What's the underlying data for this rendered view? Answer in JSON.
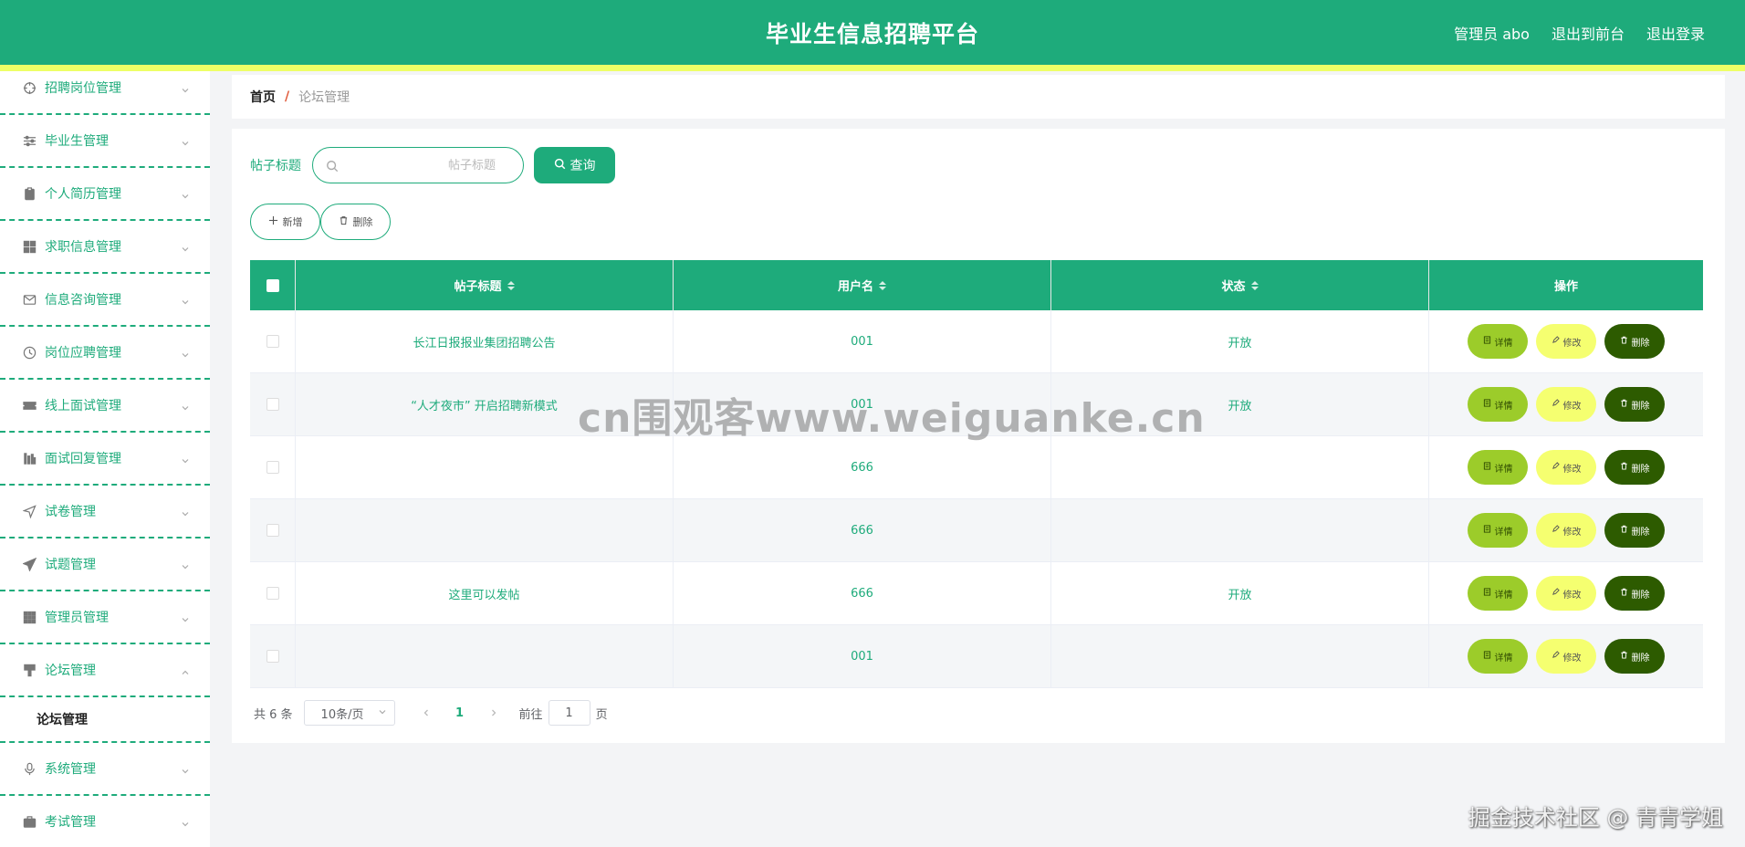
{
  "header": {
    "title": "毕业生信息招聘平台",
    "admin_label": "管理员 abo",
    "goto_front": "退出到前台",
    "logout": "退出登录"
  },
  "sidebar": {
    "items": [
      {
        "label": "招聘岗位管理",
        "icon": "crosshair-icon"
      },
      {
        "label": "毕业生管理",
        "icon": "sliders-icon"
      },
      {
        "label": "个人简历管理",
        "icon": "clipboard-icon"
      },
      {
        "label": "求职信息管理",
        "icon": "grid-icon"
      },
      {
        "label": "信息咨询管理",
        "icon": "mail-icon"
      },
      {
        "label": "岗位应聘管理",
        "icon": "clock-icon"
      },
      {
        "label": "线上面试管理",
        "icon": "ticket-icon"
      },
      {
        "label": "面试回复管理",
        "icon": "bars-icon"
      },
      {
        "label": "试卷管理",
        "icon": "navigation-icon"
      },
      {
        "label": "试题管理",
        "icon": "send-icon"
      },
      {
        "label": "管理员管理",
        "icon": "apps-icon"
      },
      {
        "label": "论坛管理",
        "icon": "brush-icon",
        "expanded": true
      },
      {
        "label": "系统管理",
        "icon": "microphone-icon"
      },
      {
        "label": "考试管理",
        "icon": "briefcase-icon"
      }
    ],
    "submenu": {
      "label": "论坛管理"
    }
  },
  "breadcrumb": {
    "home": "首页",
    "separator": "/",
    "current": "论坛管理"
  },
  "search": {
    "label": "帖子标题",
    "placeholder": "帖子标题",
    "query_label": "查询"
  },
  "actions": {
    "add_label": "新增",
    "delete_label": "删除"
  },
  "table": {
    "columns": [
      "帖子标题",
      "用户名",
      "状态",
      "操作"
    ],
    "rows": [
      {
        "title": "长江日报报业集团招聘公告",
        "username": "001",
        "status": "开放"
      },
      {
        "title": "“人才夜市” 开启招聘新模式",
        "username": "001",
        "status": "开放"
      },
      {
        "title": "",
        "username": "666",
        "status": ""
      },
      {
        "title": "",
        "username": "666",
        "status": ""
      },
      {
        "title": "这里可以发帖",
        "username": "666",
        "status": "开放"
      },
      {
        "title": "",
        "username": "001",
        "status": ""
      }
    ],
    "op_labels": {
      "detail": "详情",
      "edit": "修改",
      "delete": "删除"
    }
  },
  "pagination": {
    "total": "共 6 条",
    "page_size": "10条/页",
    "current_page": "1",
    "goto_prefix": "前往",
    "goto_value": "1",
    "goto_suffix": "页"
  },
  "watermarks": {
    "center": "cn围观客www.weiguanke.cn",
    "corner": "掘金技术社区 @ 青青学姐"
  },
  "colors": {
    "primary": "#1eab7b",
    "stripe": "#eeff66",
    "detail_btn": "#9ccc2a",
    "edit_btn": "#f5ff70",
    "delete_btn": "#2d5b00"
  }
}
